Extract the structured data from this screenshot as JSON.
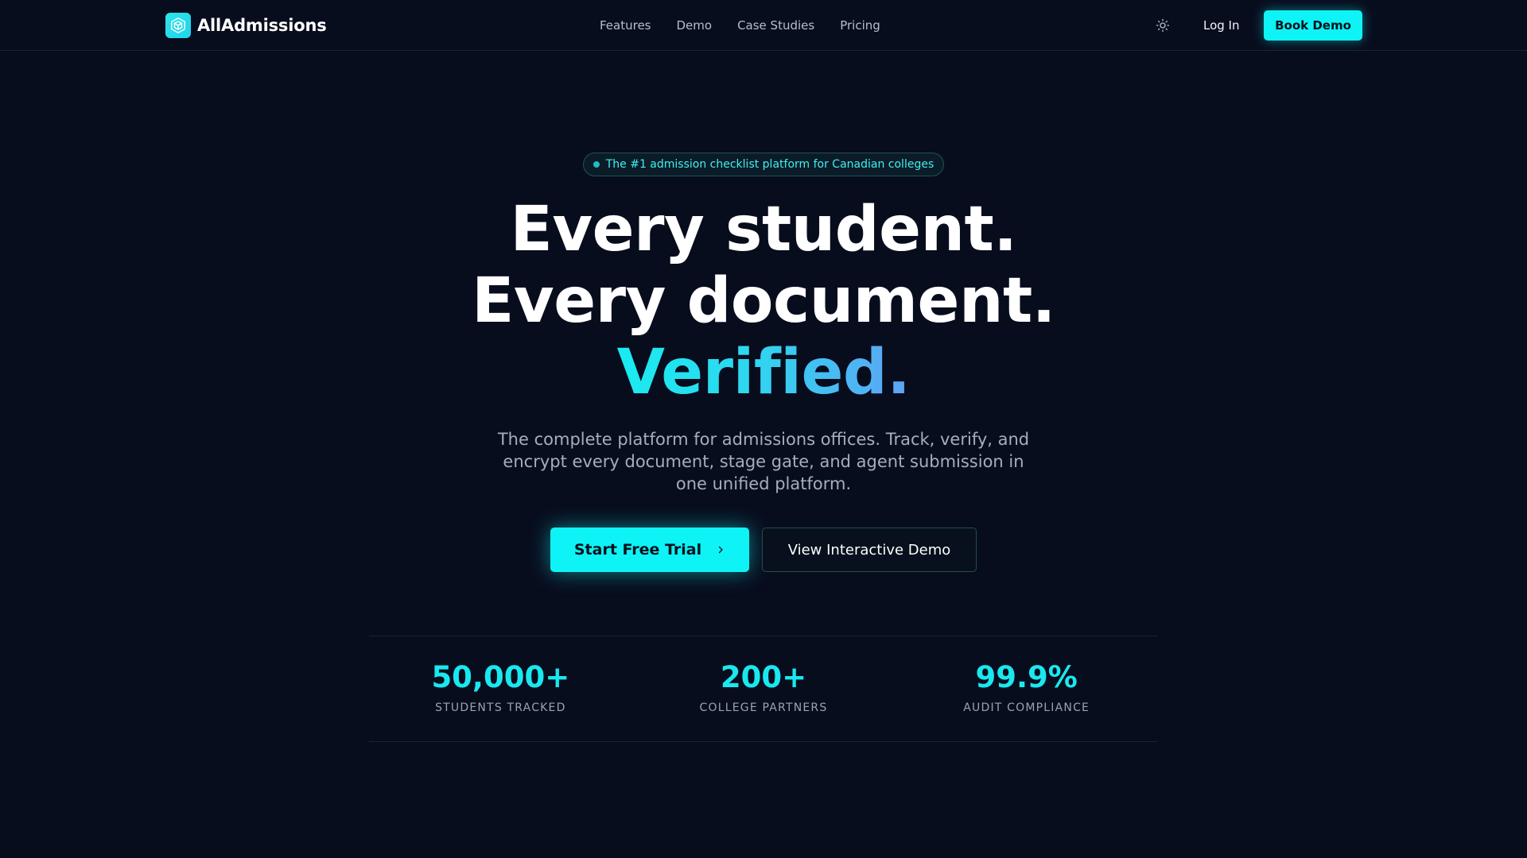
{
  "brand": {
    "name": "AllAdmissions",
    "logo_icon": "hexagon-logo-icon",
    "accent": "#0ef3f5"
  },
  "nav": {
    "links": [
      {
        "label": "Features"
      },
      {
        "label": "Demo"
      },
      {
        "label": "Case Studies"
      },
      {
        "label": "Pricing"
      }
    ],
    "theme_icon": "sun-icon",
    "login_label": "Log In",
    "book_demo_label": "Book Demo"
  },
  "hero": {
    "badge": "The #1 admission checklist platform for Canadian colleges",
    "headline_line1": "Every student.",
    "headline_line2": "Every document.",
    "headline_accent": "Verified.",
    "subtitle": "The complete platform for admissions offices. Track, verify, and encrypt every document, stage gate, and agent submission in one unified platform.",
    "cta_primary": "Start Free Trial",
    "cta_primary_icon": "chevron-right-icon",
    "cta_secondary": "View Interactive Demo"
  },
  "stats": [
    {
      "value": "50,000+",
      "label": "STUDENTS TRACKED"
    },
    {
      "value": "200+",
      "label": "COLLEGE PARTNERS"
    },
    {
      "value": "99.9%",
      "label": "AUDIT COMPLIANCE"
    }
  ]
}
